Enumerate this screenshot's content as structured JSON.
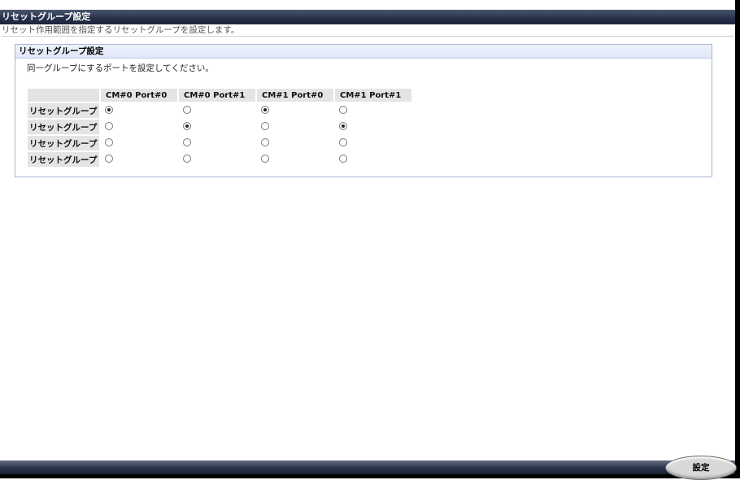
{
  "window": {
    "title": "リセットグループ設定",
    "description": "リセット作用範囲を指定するリセットグループを設定します。"
  },
  "panel": {
    "header": "リセットグループ設定",
    "instruction": "同一グループにするポートを設定してください。"
  },
  "table": {
    "columns": [
      "CM#0 Port#0",
      "CM#0 Port#1",
      "CM#1 Port#0",
      "CM#1 Port#1"
    ],
    "rows": [
      {
        "label": "リセットグループ",
        "selected": [
          true,
          false,
          true,
          false
        ]
      },
      {
        "label": "リセットグループ",
        "selected": [
          false,
          true,
          false,
          true
        ]
      },
      {
        "label": "リセットグループ",
        "selected": [
          false,
          false,
          false,
          false
        ]
      },
      {
        "label": "リセットグループ",
        "selected": [
          false,
          false,
          false,
          false
        ]
      }
    ]
  },
  "footer": {
    "button_label": "設定"
  }
}
